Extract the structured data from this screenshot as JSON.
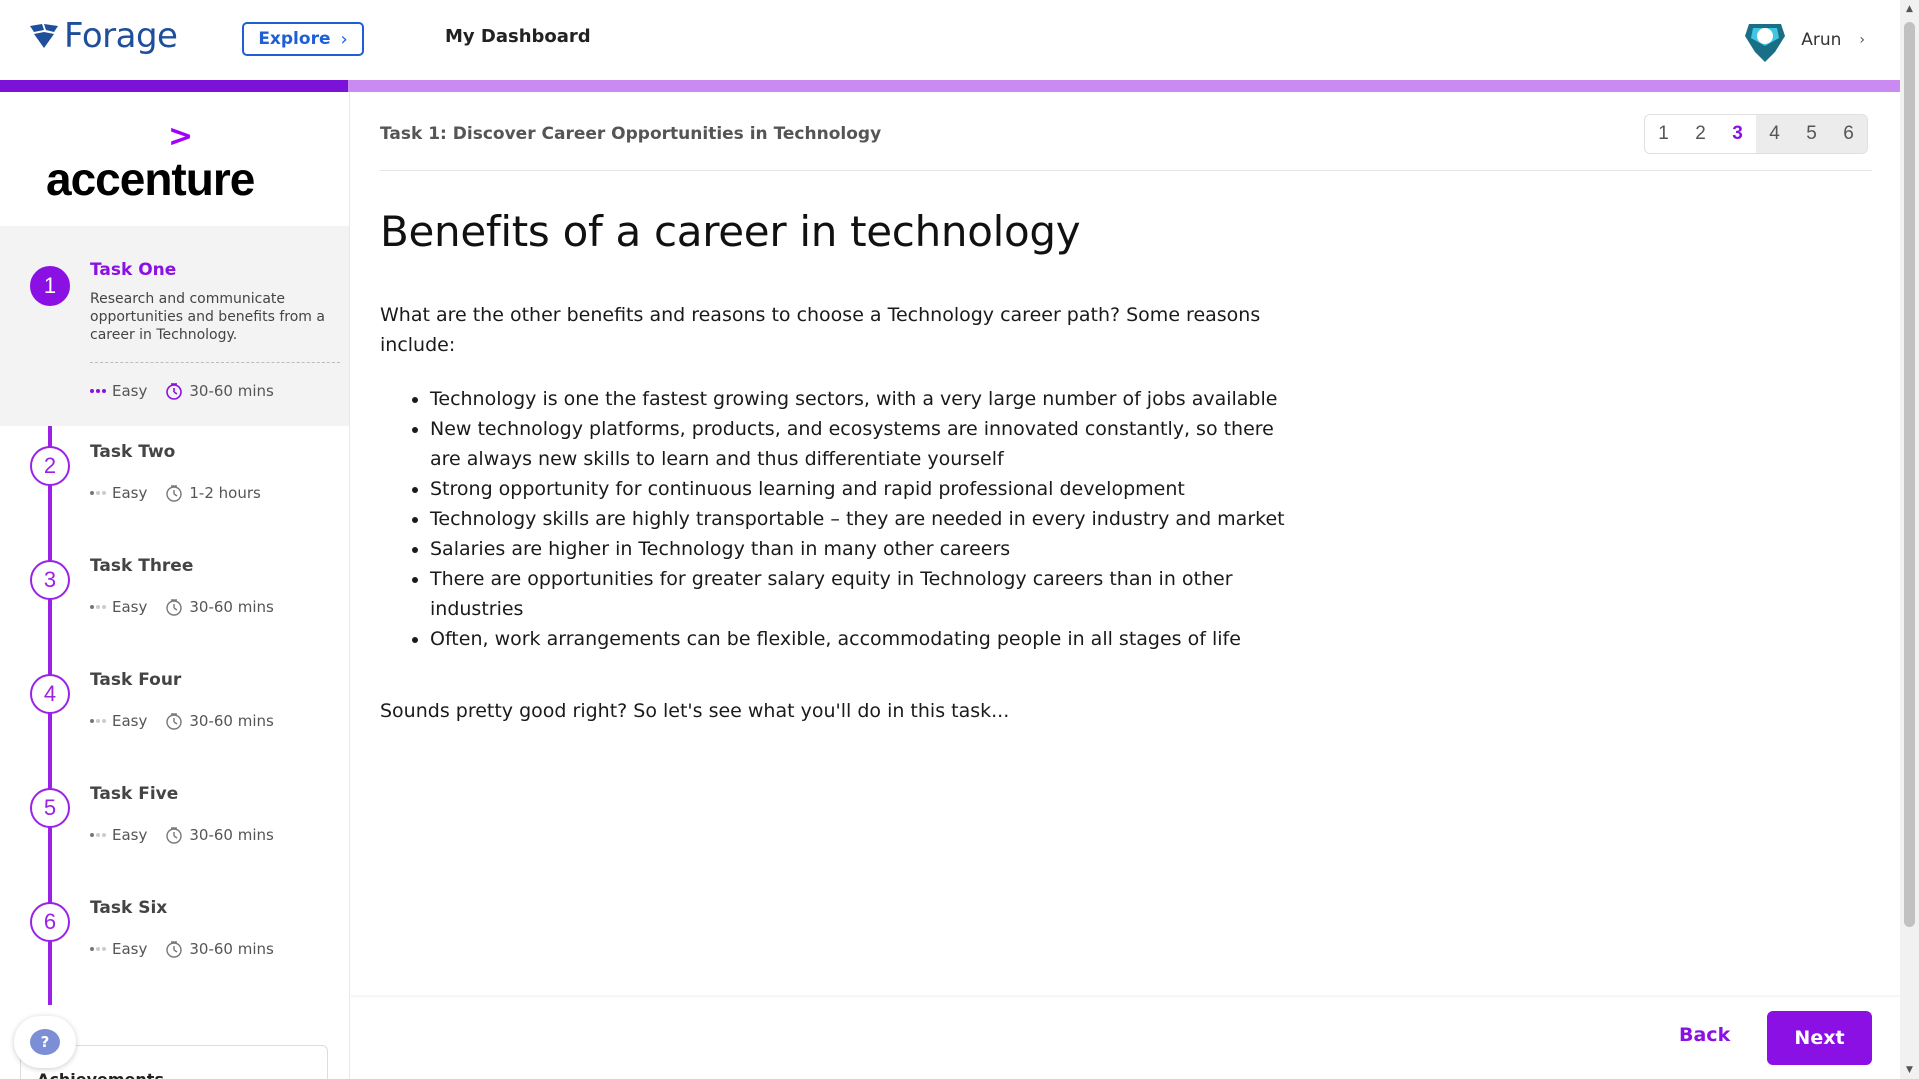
{
  "header": {
    "logo_text": "Forage",
    "explore_label": "Explore",
    "dashboard_label": "My Dashboard",
    "user_name": "Arun"
  },
  "progress": {
    "fraction": 0.183
  },
  "sidebar": {
    "brand": "accenture",
    "tasks": [
      {
        "num": "1",
        "title": "Task One",
        "desc": "Research and communicate opportunities and benefits from a career in Technology.",
        "difficulty": "Easy",
        "duration": "30-60 mins"
      },
      {
        "num": "2",
        "title": "Task Two",
        "difficulty": "Easy",
        "duration": "1-2 hours"
      },
      {
        "num": "3",
        "title": "Task Three",
        "difficulty": "Easy",
        "duration": "30-60 mins"
      },
      {
        "num": "4",
        "title": "Task Four",
        "difficulty": "Easy",
        "duration": "30-60 mins"
      },
      {
        "num": "5",
        "title": "Task Five",
        "difficulty": "Easy",
        "duration": "30-60 mins"
      },
      {
        "num": "6",
        "title": "Task Six",
        "difficulty": "Easy",
        "duration": "30-60 mins"
      }
    ],
    "help_label": "?",
    "achievements_label": "Achievements"
  },
  "main": {
    "breadcrumb": "Task 1: Discover Career Opportunities in Technology",
    "pages": [
      "1",
      "2",
      "3",
      "4",
      "5",
      "6"
    ],
    "current_page": "3",
    "heading": "Benefits of a career in technology",
    "intro": "What are the other benefits and reasons to choose a Technology career path? Some reasons include:",
    "bullets": [
      "Technology is one the fastest growing sectors, with a very large number of jobs available",
      "New technology platforms, products, and ecosystems are innovated constantly, so there are always new skills to learn and thus differentiate yourself",
      "Strong opportunity for continuous learning and rapid professional development",
      "Technology skills are highly transportable – they are needed in every industry and market",
      "Salaries are higher in Technology than in many other careers",
      "There are opportunities for greater salary equity in Technology careers than in other industries",
      "Often, work arrangements can be flexible, accommodating people in all stages of life"
    ],
    "outro": "Sounds pretty good right? So let's see what you'll do in this task...",
    "back_label": "Back",
    "next_label": "Next"
  },
  "colors": {
    "accent": "#8a10e3",
    "progress_track": "#c98af1",
    "forage_blue": "#1f5fd6"
  }
}
